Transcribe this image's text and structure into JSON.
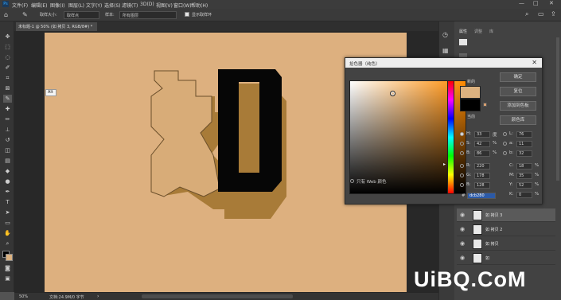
{
  "menu": [
    "文件(F)",
    "编辑(E)",
    "图像(I)",
    "图层(L)",
    "文字(Y)",
    "选择(S)",
    "滤镜(T)",
    "3D(D)",
    "视图(V)",
    "窗口(W)",
    "帮助(H)"
  ],
  "options": {
    "size_label": "取样大小:",
    "size_value": "取样点",
    "sample_label": "样本:",
    "sample_value": "所有图层",
    "show_ring_label": "显示取样环"
  },
  "document_tab": "未标题-1 @ 50% (如 拷贝 3, RGB/8#) *",
  "tooltip": "Alt",
  "status": {
    "zoom": "50%",
    "doc": "文档:24.9M/0 字节"
  },
  "panel_tabs": [
    "属性",
    "调整",
    "库"
  ],
  "layers": [
    "如 拷贝 3",
    "如 拷贝 2",
    "如 拷贝",
    "如"
  ],
  "dialog": {
    "title": "拾色器（纯色）",
    "new_label": "新的",
    "current_label": "当前",
    "buttons": [
      "确定",
      "复位",
      "添加到色板",
      "颜色库"
    ],
    "web_only_label": "只有 Web 颜色",
    "fields": {
      "H": "33",
      "H_unit": "度",
      "S": "42",
      "S_unit": "%",
      "B": "86",
      "B_unit": "%",
      "R": "220",
      "G": "178",
      "Bb": "128",
      "L": "76",
      "a": "11",
      "b": "32",
      "C": "18",
      "M": "35",
      "Y": "52",
      "K": "0",
      "hex": "dcb280"
    },
    "colors": {
      "new": "#dcb280",
      "current": "#000000"
    }
  },
  "watermark": "UiBQ.CoM"
}
